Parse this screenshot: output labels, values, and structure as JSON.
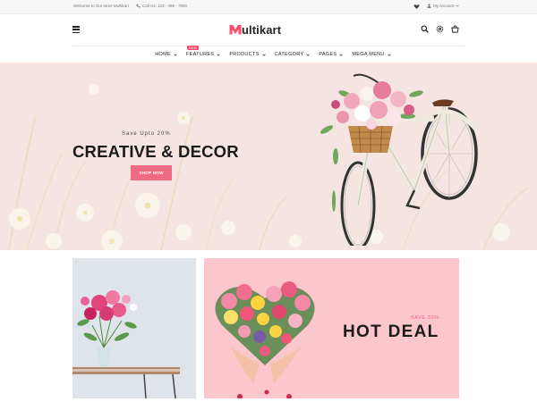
{
  "topbar": {
    "welcome": "Welcome to Our store Multikart",
    "call": "Call Us: 123 - 456 - 7890",
    "account": "My Account"
  },
  "header": {
    "logo_initial": "M",
    "logo_rest": "ultikart"
  },
  "nav": {
    "items": [
      {
        "label": "HOME"
      },
      {
        "label": "FEATURES",
        "badge": "NEW"
      },
      {
        "label": "PRODUCTS"
      },
      {
        "label": "CATEGORY"
      },
      {
        "label": "PAGES"
      },
      {
        "label": "MEGA MENU"
      }
    ]
  },
  "hero": {
    "pretitle": "Save Upto 20%",
    "title": "CREATIVE & DECOR",
    "button": "SHOP NOW"
  },
  "banner_right": {
    "save": "SAVE 30%",
    "title": "HOT DEAL"
  },
  "colors": {
    "accent": "#ff4c6b",
    "hero_bg": "#f6e4e3",
    "banner_pink": "#fbc6cc",
    "button": "#ef6b83"
  }
}
